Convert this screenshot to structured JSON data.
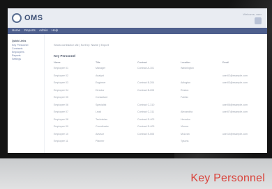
{
  "app": {
    "logo_text": "OMS",
    "header_user": "Welcome, user"
  },
  "menubar": {
    "items": [
      "Home",
      "Reports",
      "Admin",
      "Help"
    ]
  },
  "sidebar": {
    "links": [
      "Quick Links",
      "Key Personnel",
      "Contracts",
      "Employees",
      "Reports",
      "Settings"
    ]
  },
  "main": {
    "filter_text": "Show contractor: All | Sort by: Name | Export",
    "section_title": "Key Personnel",
    "columns": [
      "Name",
      "Title",
      "Contract",
      "Location",
      "Email"
    ],
    "rows": [
      [
        "Employee 01",
        "Manager",
        "Contract A-101",
        "Washington",
        ""
      ],
      [
        "Employee 02",
        "Analyst",
        "",
        "",
        "user02@example.com"
      ],
      [
        "Employee 03",
        "Engineer",
        "Contract B-204",
        "Arlington",
        "user03@example.com"
      ],
      [
        "Employee 04",
        "Director",
        "Contract B-205",
        "Reston",
        ""
      ],
      [
        "Employee 05",
        "Consultant",
        "",
        "Fairfax",
        ""
      ],
      [
        "Employee 06",
        "Specialist",
        "Contract C-310",
        "",
        "user06@example.com"
      ],
      [
        "Employee 07",
        "Lead",
        "Contract C-311",
        "Alexandria",
        "user07@example.com"
      ],
      [
        "Employee 08",
        "Technician",
        "Contract D-402",
        "Herndon",
        ""
      ],
      [
        "Employee 09",
        "Coordinator",
        "Contract D-403",
        "Vienna",
        ""
      ],
      [
        "Employee 10",
        "Advisor",
        "Contract E-505",
        "McLean",
        "user10@example.com"
      ],
      [
        "Employee 11",
        "Planner",
        "",
        "Tysons",
        ""
      ]
    ]
  },
  "caption": "Key Personnel"
}
